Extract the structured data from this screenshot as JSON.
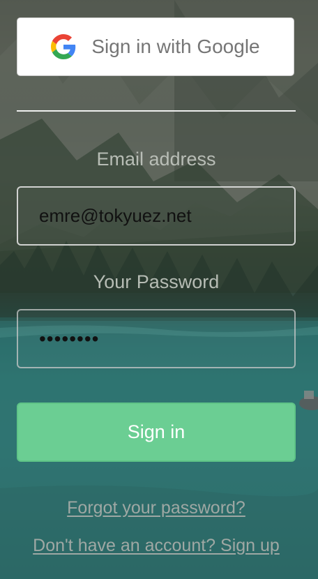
{
  "google": {
    "label": "Sign in with Google"
  },
  "email": {
    "label": "Email address",
    "value": "emre@tokyuez.net"
  },
  "password": {
    "label": "Your Password",
    "value": "••••••••"
  },
  "signin": {
    "label": "Sign in"
  },
  "links": {
    "forgot": "Forgot your password?",
    "signup": "Don't have an account? Sign up"
  },
  "colors": {
    "primary": "#6bce93",
    "google_text": "#757575",
    "link": "#a5aca8"
  }
}
